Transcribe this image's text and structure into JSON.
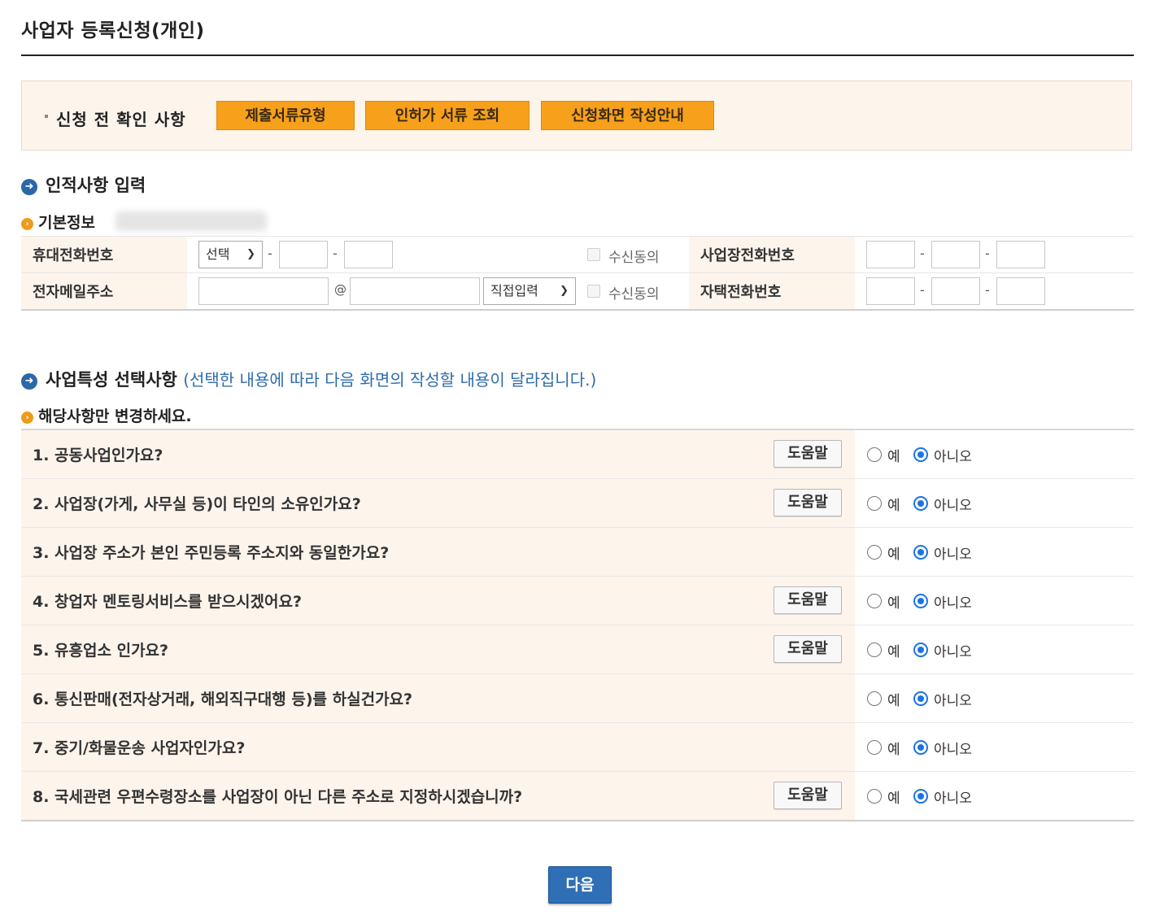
{
  "page": {
    "title": "사업자 등록신청(개인)"
  },
  "notice": {
    "label": "신청 전 확인 사항",
    "buttons": [
      "제출서류유형",
      "인허가 서류 조회",
      "신청화면 작성안내"
    ]
  },
  "identity": {
    "heading": "인적사항 입력",
    "subheading": "기본정보",
    "mobile_label": "휴대전화번호",
    "mobile_select": "선택",
    "consent_label": "수신동의",
    "business_phone_label": "사업장전화번호",
    "email_label": "전자메일주소",
    "email_at": "@",
    "email_domain_select": "직접입력",
    "home_phone_label": "자택전화번호",
    "dash": "-"
  },
  "business": {
    "heading": "사업특성 선택사항",
    "heading_note": "(선택한 내용에 따라 다음 화면의 작성할 내용이 달라집니다.)",
    "subheading": "해당사항만 변경하세요.",
    "help_label": "도움말",
    "yes_label": "예",
    "no_label": "아니오",
    "questions": [
      {
        "text": "1. 공동사업인가요?",
        "has_help": true,
        "answer": "아니오"
      },
      {
        "text": "2. 사업장(가게, 사무실 등)이 타인의 소유인가요?",
        "has_help": true,
        "answer": "아니오"
      },
      {
        "text": "3. 사업장 주소가 본인 주민등록 주소지와 동일한가요?",
        "has_help": false,
        "answer": "아니오"
      },
      {
        "text": "4. 창업자 멘토링서비스를 받으시겠어요?",
        "has_help": true,
        "answer": "아니오"
      },
      {
        "text": "5. 유흥업소 인가요?",
        "has_help": true,
        "answer": "아니오"
      },
      {
        "text": "6. 통신판매(전자상거래, 해외직구대행 등)를 하실건가요?",
        "has_help": false,
        "answer": "아니오"
      },
      {
        "text": "7. 중기/화물운송 사업자인가요?",
        "has_help": false,
        "answer": "아니오"
      },
      {
        "text": "8. 국세관련 우편수령장소를 사업장이 아닌 다른 주소로 지정하시겠습니까?",
        "has_help": true,
        "answer": "아니오"
      }
    ]
  },
  "footer": {
    "next_label": "다음"
  },
  "colors": {
    "accent_orange": "#f7a01b",
    "accent_blue": "#2f6fb5",
    "label_bg": "#fdf4ec",
    "radio_checked": "#1a73e8"
  }
}
